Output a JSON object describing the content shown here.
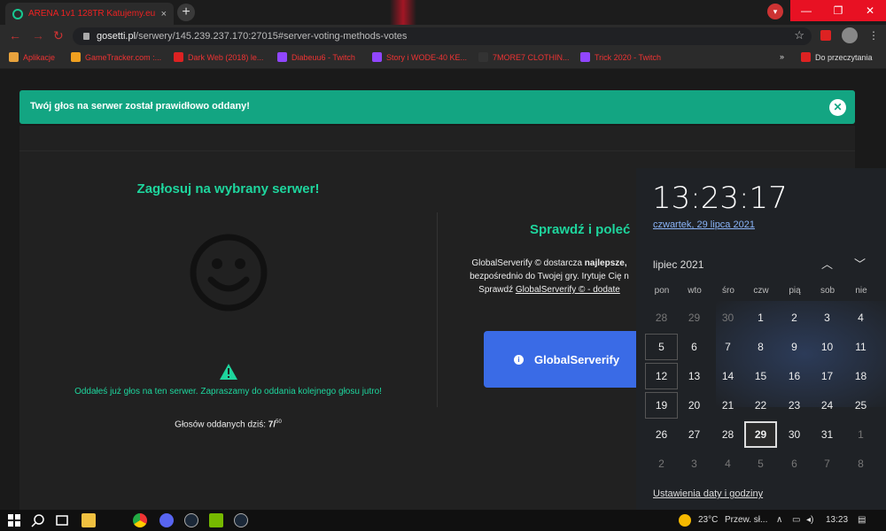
{
  "browser": {
    "tab_title": "ARENA 1v1 128TR Katujemy.eu ⋅",
    "tab_close": "×",
    "new_tab": "+",
    "window_controls": {
      "minimize": "—",
      "maximize": "❐",
      "close": "✕"
    },
    "url_host": "gosetti.pl",
    "url_path": "/serwery/145.239.237.170:27015#server-voting-methods-votes",
    "star": "☆",
    "menu": "⋮",
    "bookmarks": [
      {
        "label": "Aplikacje",
        "icon_color": "#e8a33d"
      },
      {
        "label": "GameTracker.com :...",
        "icon_color": "#f0a020"
      },
      {
        "label": "Dark Web (2018) le...",
        "icon_color": "#d22"
      },
      {
        "label": "Diabeuu6 - Twitch",
        "icon_color": "#9146ff"
      },
      {
        "label": "Story i WODE-40 KE...",
        "icon_color": "#9146ff"
      },
      {
        "label": "7MORE7 CLOTHIN...",
        "icon_color": "#333"
      },
      {
        "label": "Trick 2020 - Twitch",
        "icon_color": "#9146ff"
      }
    ],
    "more_bookmarks": "»",
    "reading_list": "Do przeczytania"
  },
  "page": {
    "alert_text": "Twój głos na serwer został prawidłowo oddany!",
    "alert_close": "✕",
    "vote_title": "Zagłosuj na wybrany serwer!",
    "voted_message": "Oddałeś już głos na ten serwer. Zapraszamy do oddania kolejnego głosu jutro!",
    "votes_today_label": "Głosów oddanych dziś:",
    "votes_today_value": "7/",
    "votes_today_max": "50",
    "check_title": "Sprawdź i poleć",
    "check_desc_1": "GlobalServerify © dostarcza",
    "check_desc_bold": "najlepsze,",
    "check_desc_2": "bezpośrednio do Twojej gry. Irytuje Cię n",
    "check_desc_3": "Sprawdź",
    "check_desc_link": "GlobalServerify © - dodate",
    "gs_button": "GlobalServerify",
    "gs_info": "i",
    "accent_color": "#1ed59d",
    "alert_color": "#13a582",
    "button_color": "#3a6be6"
  },
  "calendar": {
    "time": "13:23:17",
    "date_long": "czwartek, 29 lipca 2021",
    "month": "lipiec 2021",
    "up": "︿",
    "down": "﹀",
    "weekdays": [
      "pon",
      "wto",
      "śro",
      "czw",
      "pią",
      "sob",
      "nie"
    ],
    "weeks": [
      [
        "28",
        "29",
        "30",
        "1",
        "2",
        "3",
        "4"
      ],
      [
        "5",
        "6",
        "7",
        "8",
        "9",
        "10",
        "11"
      ],
      [
        "12",
        "13",
        "14",
        "15",
        "16",
        "17",
        "18"
      ],
      [
        "19",
        "20",
        "21",
        "22",
        "23",
        "24",
        "25"
      ],
      [
        "26",
        "27",
        "28",
        "29",
        "30",
        "31",
        "1"
      ],
      [
        "2",
        "3",
        "4",
        "5",
        "6",
        "7",
        "8"
      ]
    ],
    "today": "29",
    "settings_link": "Ustawienia daty i godziny"
  },
  "taskbar": {
    "weather": "23°C",
    "weather_desc": "Przew. sł...",
    "tray_chevron": "∧",
    "time": "13:23"
  }
}
